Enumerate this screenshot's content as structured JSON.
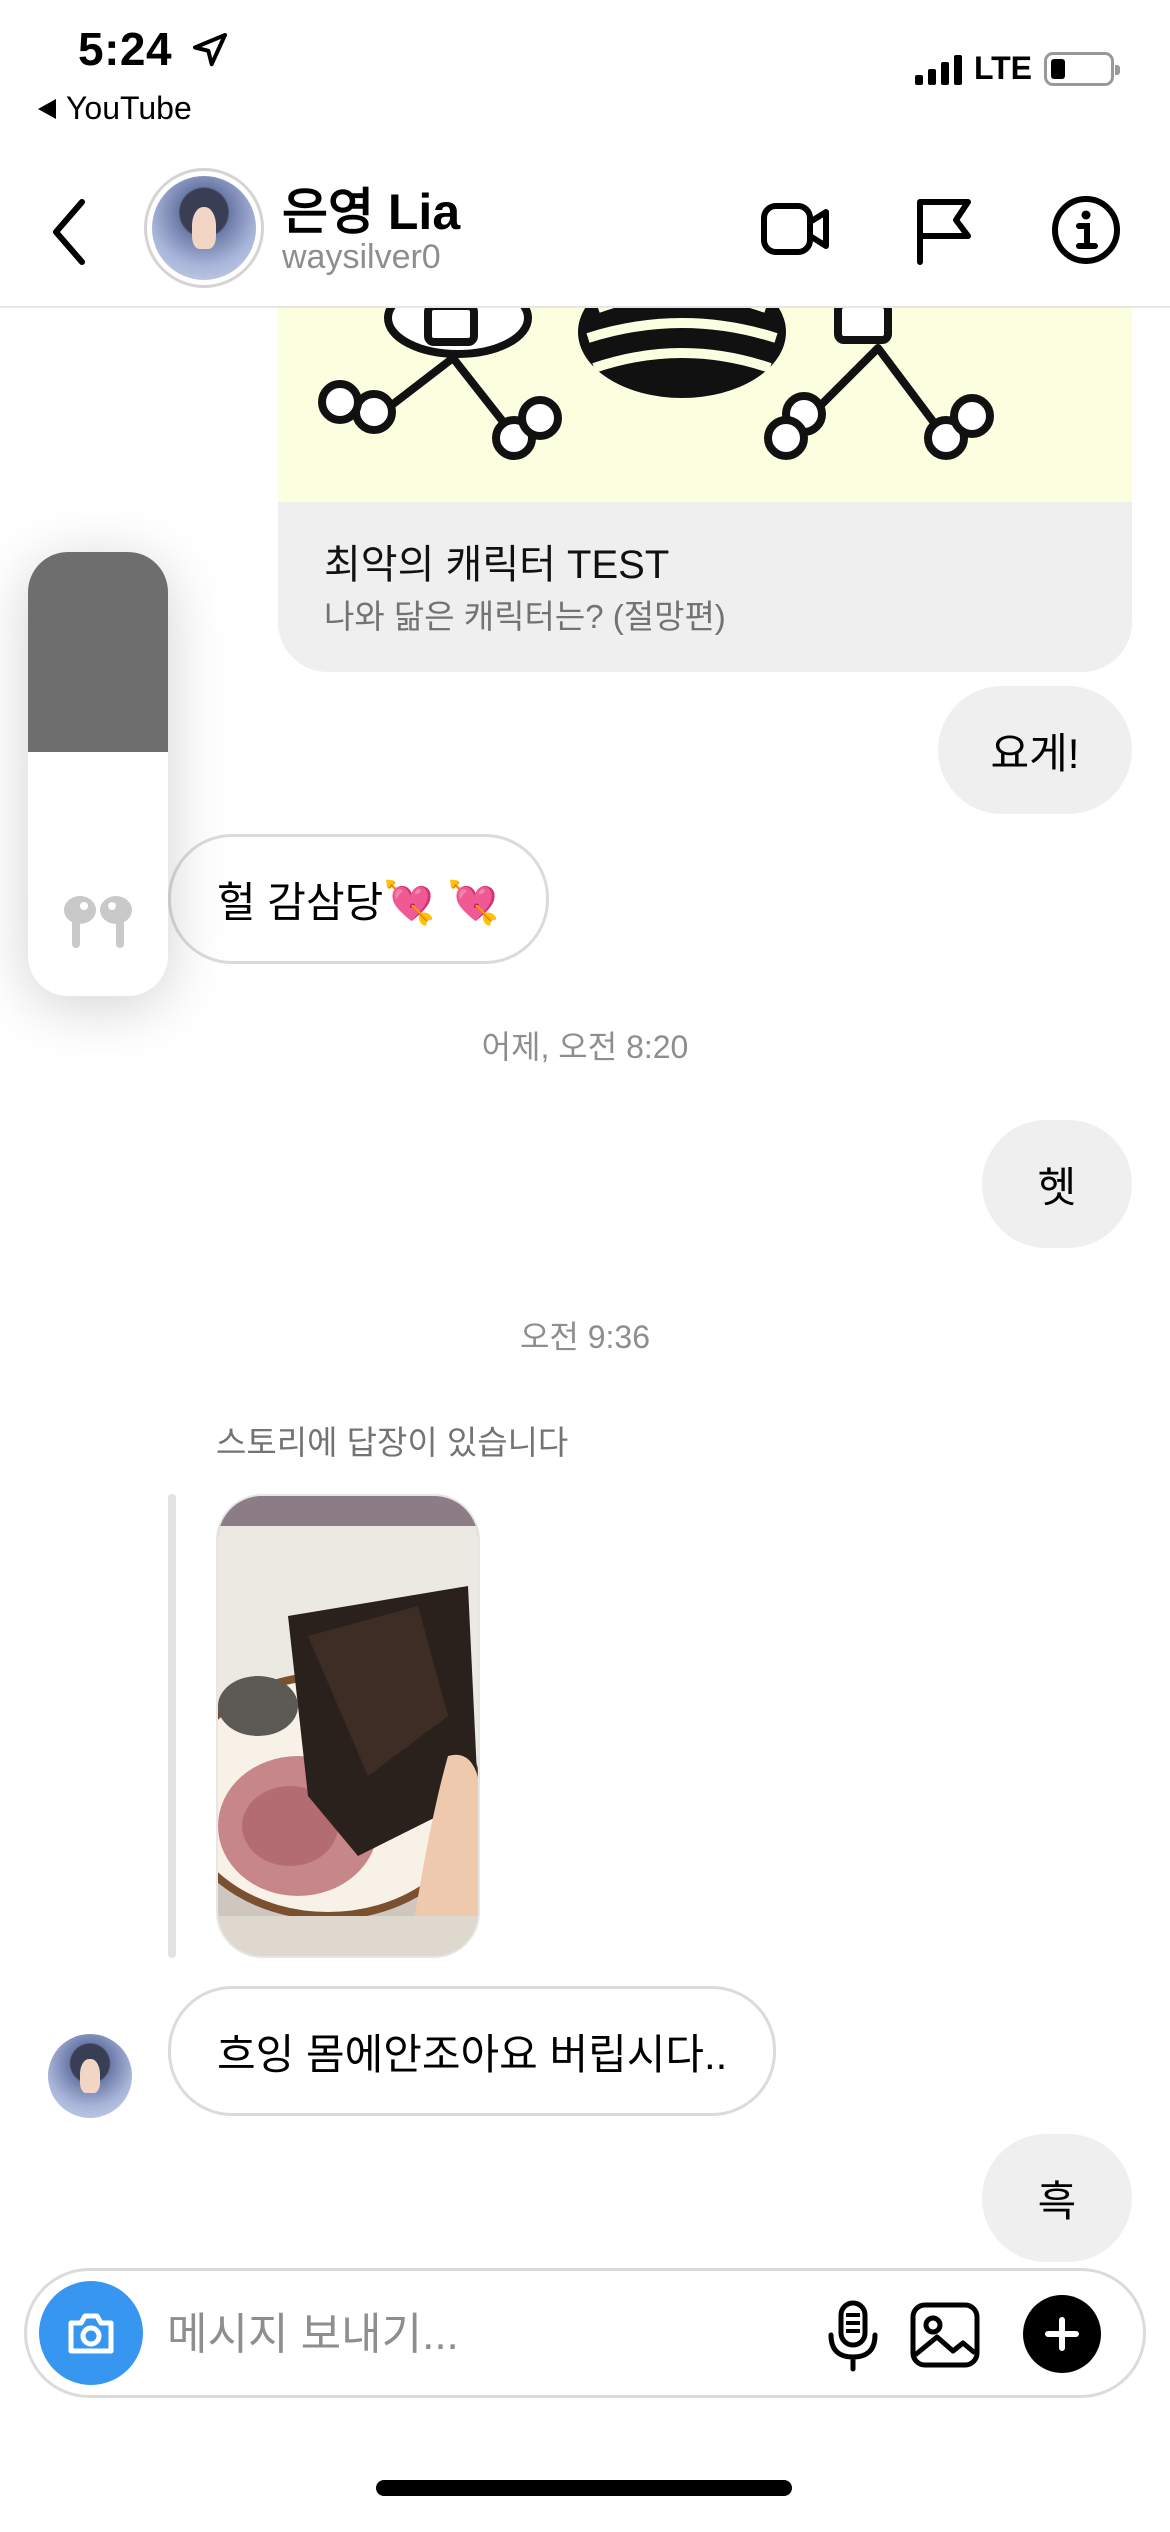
{
  "status_bar": {
    "time": "5:24",
    "back_app": "YouTube",
    "network": "LTE",
    "battery_level": 0.25
  },
  "header": {
    "name": "은영 Lia",
    "username": "waysilver0",
    "icons": [
      "back-chevron-icon",
      "video-call-icon",
      "flag-icon",
      "info-icon"
    ]
  },
  "messages": {
    "link_card": {
      "title": "최악의 캐릭터 TEST",
      "subtitle": "나와 닮은 캐릭터는? (절망편)"
    },
    "m1": "요게!",
    "m2": "헐 감삼당💘 💘",
    "ts1": "어제, 오전 8:20",
    "m3": "헷",
    "ts2": "오전 9:36",
    "story_reply_label": "스토리에 답장이 있습니다",
    "m4": "흐잉 몸에안조아요 버립시다..",
    "m5": "흑"
  },
  "volume_overlay": {
    "level": 0.45,
    "device_icon": "airpods-icon"
  },
  "composer": {
    "placeholder": "메시지 보내기...",
    "value": "",
    "icons": [
      "camera-icon",
      "microphone-icon",
      "gallery-icon",
      "plus-icon"
    ]
  },
  "colors": {
    "accent": "#3797f0",
    "bubble_mine": "#efefef",
    "border": "#dbdbdb",
    "secondary_text": "#8e8e8e"
  }
}
